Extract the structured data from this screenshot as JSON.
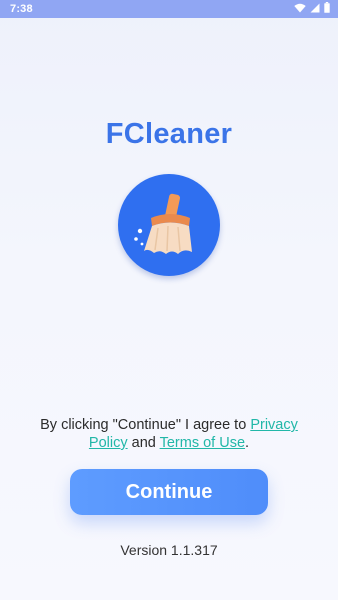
{
  "status_bar": {
    "time": "7:38",
    "icons": [
      "wifi-icon",
      "signal-icon",
      "battery-icon"
    ],
    "background": "#90a6f3"
  },
  "app": {
    "title": "FCleaner",
    "logo_icon": "broom-icon",
    "title_color": "#3b74e8",
    "logo_color": "#2f6ff0"
  },
  "consent": {
    "prefix": "By clicking \"Continue\" I agree to ",
    "privacy_link": "Privacy Policy",
    "conjunction": " and ",
    "terms_link": "Terms of Use",
    "suffix": ".",
    "link_color": "#22b7a8"
  },
  "continue_button": {
    "label": "Continue",
    "color": "#5e9cff"
  },
  "footer": {
    "version": "Version 1.1.317"
  }
}
